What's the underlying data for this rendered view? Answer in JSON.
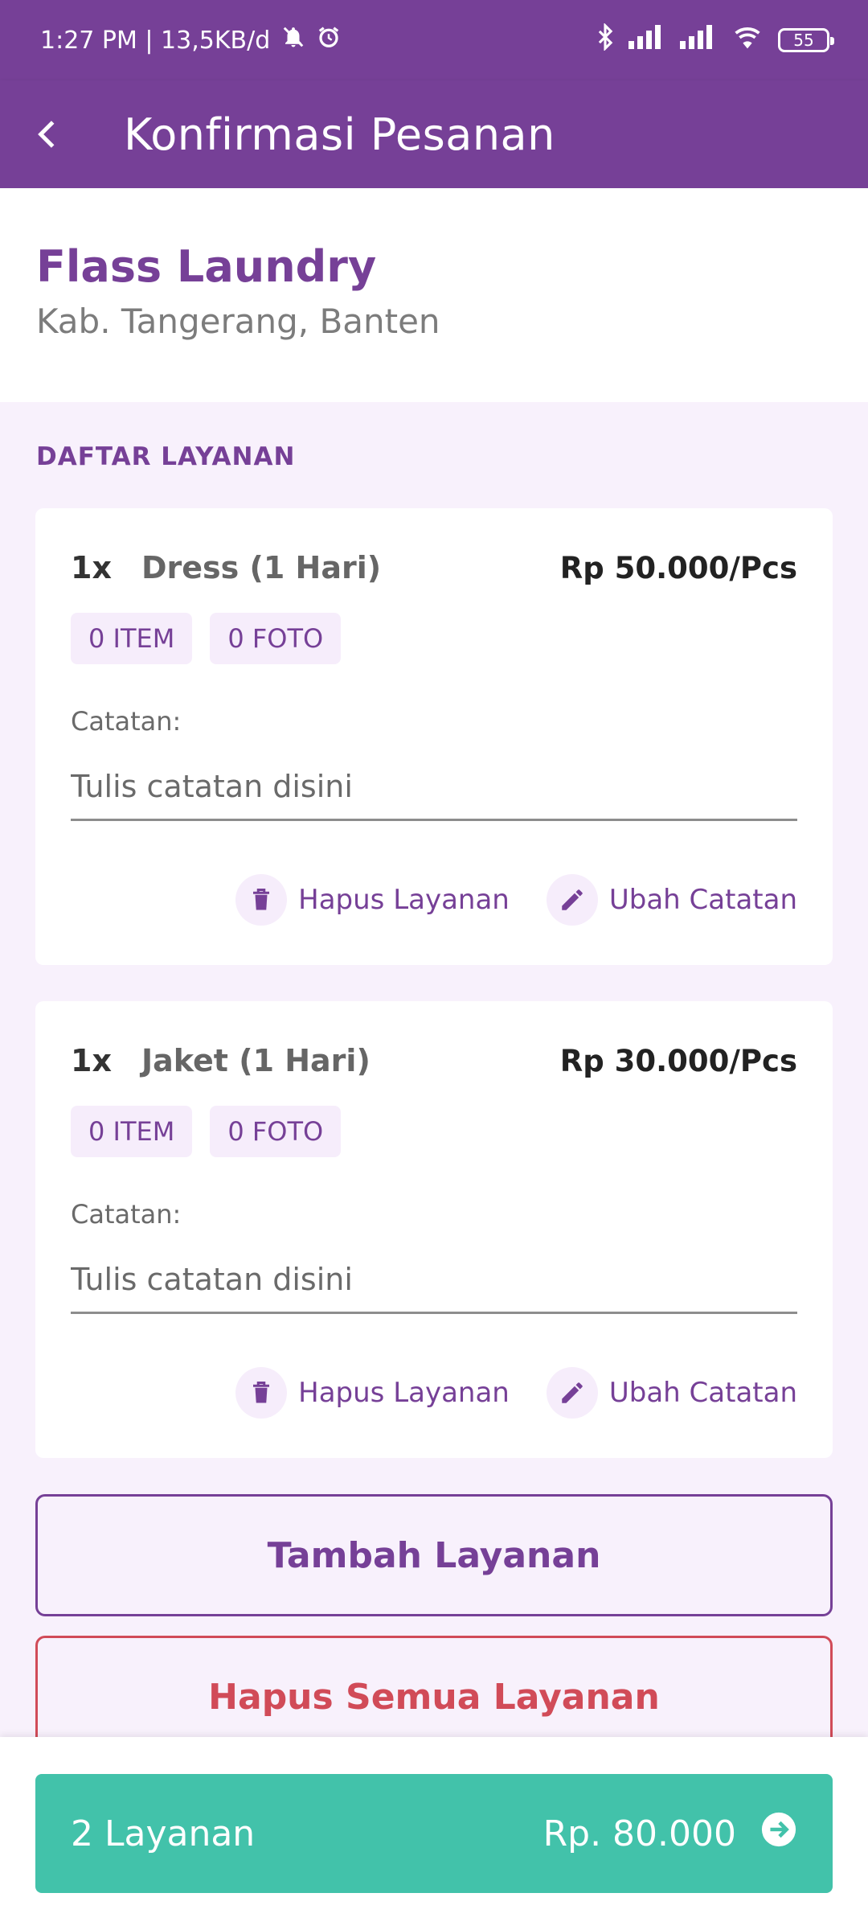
{
  "status_bar": {
    "time_info": "1:27 PM | 13,5KB/d",
    "battery": "55"
  },
  "app_bar": {
    "title": "Konfirmasi Pesanan"
  },
  "store": {
    "name": "Flass Laundry",
    "location": "Kab. Tangerang, Banten"
  },
  "section_title": "DAFTAR LAYANAN",
  "services": [
    {
      "qty": "1x",
      "name": "Dress (1 Hari)",
      "price": "Rp 50.000/Pcs",
      "item_chip": "0 ITEM",
      "photo_chip": "0 FOTO",
      "note_label": "Catatan:",
      "note_placeholder": "Tulis catatan disini",
      "delete_label": "Hapus Layanan",
      "edit_label": "Ubah Catatan"
    },
    {
      "qty": "1x",
      "name": "Jaket (1 Hari)",
      "price": "Rp 30.000/Pcs",
      "item_chip": "0 ITEM",
      "photo_chip": "0 FOTO",
      "note_label": "Catatan:",
      "note_placeholder": "Tulis catatan disini",
      "delete_label": "Hapus Layanan",
      "edit_label": "Ubah Catatan"
    }
  ],
  "buttons": {
    "add_service": "Tambah Layanan",
    "delete_all": "Hapus Semua Layanan"
  },
  "checkout": {
    "count_label": "2 Layanan",
    "total": "Rp. 80.000"
  },
  "colors": {
    "primary": "#764097",
    "accent": "#42c2aa",
    "danger": "#d14b58",
    "background": "#f8f1fc"
  }
}
